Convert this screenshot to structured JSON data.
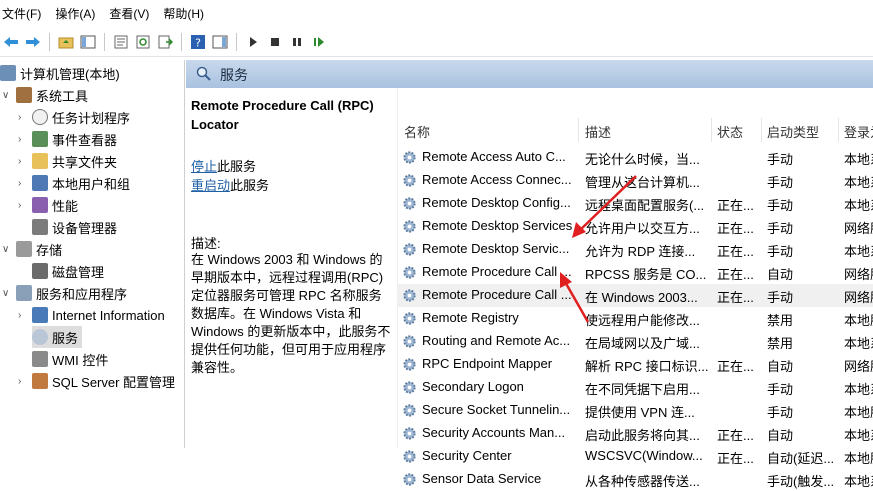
{
  "menu": [
    "文件(F)",
    "操作(A)",
    "查看(V)",
    "帮助(H)"
  ],
  "tree": [
    {
      "label": "计算机管理(本地)",
      "chev": "",
      "icon": "computer-icon"
    },
    {
      "label": "系统工具",
      "chev": "∨",
      "icon": "tools-icon"
    },
    {
      "label": "任务计划程序",
      "chev": "›",
      "icon": "clock-icon"
    },
    {
      "label": "事件查看器",
      "chev": "›",
      "icon": "event-viewer-icon"
    },
    {
      "label": "共享文件夹",
      "chev": "›",
      "icon": "shared-folder-icon"
    },
    {
      "label": "本地用户和组",
      "chev": "›",
      "icon": "users-icon"
    },
    {
      "label": "性能",
      "chev": "›",
      "icon": "performance-icon"
    },
    {
      "label": "设备管理器",
      "chev": "",
      "icon": "device-manager-icon"
    },
    {
      "label": "存储",
      "chev": "∨",
      "icon": "storage-icon"
    },
    {
      "label": "磁盘管理",
      "chev": "",
      "icon": "disk-icon"
    },
    {
      "label": "服务和应用程序",
      "chev": "∨",
      "icon": "services-apps-icon"
    },
    {
      "label": "Internet Information",
      "chev": "›",
      "icon": "iis-icon"
    },
    {
      "label": "服务",
      "chev": "",
      "icon": "services-icon"
    },
    {
      "label": "WMI 控件",
      "chev": "",
      "icon": "wmi-icon"
    },
    {
      "label": "SQL Server 配置管理",
      "chev": "›",
      "icon": "sql-server-icon"
    }
  ],
  "header": {
    "title": "服务"
  },
  "details": {
    "service_title": "Remote Procedure Call (RPC) Locator",
    "stop_link": "停止",
    "stop_suffix": "此服务",
    "restart_link": "重启动",
    "restart_suffix": "此服务",
    "desc_label": "描述:",
    "description": "在 Windows 2003 和 Windows 的早期版本中，远程过程调用(RPC) 定位器服务可管理 RPC 名称服务数据库。在 Windows Vista 和 Windows 的更新版本中，此服务不提供任何功能，但可用于应用程序兼容性。"
  },
  "columns": [
    "名称",
    "描述",
    "状态",
    "启动类型",
    "登录为"
  ],
  "rows": [
    [
      "Remote Access Auto C...",
      "无论什么时候，当...",
      "",
      "手动",
      "本地系"
    ],
    [
      "Remote Access Connec...",
      "管理从这台计算机...",
      "",
      "手动",
      "本地系"
    ],
    [
      "Remote Desktop Config...",
      "远程桌面配置服务(...",
      "正在...",
      "手动",
      "本地系"
    ],
    [
      "Remote Desktop Services",
      "允许用户以交互方...",
      "正在...",
      "手动",
      "网络服"
    ],
    [
      "Remote Desktop Servic...",
      "允许为 RDP 连接...",
      "正在...",
      "手动",
      "本地系"
    ],
    [
      "Remote Procedure Call ...",
      "RPCSS 服务是 CO...",
      "正在...",
      "自动",
      "网络服"
    ],
    [
      "Remote Procedure Call ...",
      "在 Windows 2003...",
      "正在...",
      "手动",
      "网络服"
    ],
    [
      "Remote Registry",
      "使远程用户能修改...",
      "",
      "禁用",
      "本地服"
    ],
    [
      "Routing and Remote Ac...",
      "在局域网以及广域...",
      "",
      "禁用",
      "本地系"
    ],
    [
      "RPC Endpoint Mapper",
      "解析 RPC 接口标识...",
      "正在...",
      "自动",
      "网络服"
    ],
    [
      "Secondary Logon",
      "在不同凭据下启用...",
      "",
      "手动",
      "本地系"
    ],
    [
      "Secure Socket Tunnelin...",
      "提供使用 VPN 连...",
      "",
      "手动",
      "本地服"
    ],
    [
      "Security Accounts Man...",
      "启动此服务将向其...",
      "正在...",
      "自动",
      "本地系"
    ],
    [
      "Security Center",
      "WSCSVC(Window...",
      "正在...",
      "自动(延迟...",
      "本地服"
    ],
    [
      "Sensor Data Service",
      "从各种传感器传送...",
      "",
      "手动(触发...",
      "本地系"
    ]
  ],
  "selected_row": 6
}
